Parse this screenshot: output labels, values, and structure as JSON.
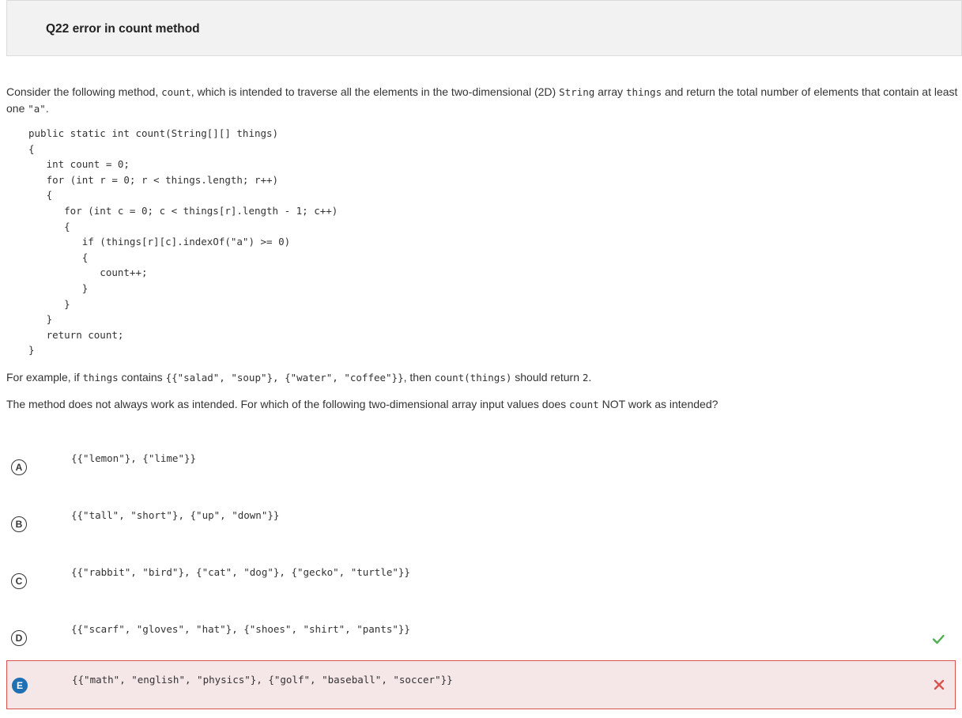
{
  "header": {
    "title": "Q22 error in count method"
  },
  "question": {
    "intro": {
      "t1": "Consider the following method, ",
      "c1": "count",
      "t2": ", which is intended to traverse all the elements in the two-dimensional (2D) ",
      "c2": "String",
      "t3": " array ",
      "c3": "things",
      "t4": " and return the total number of elements that contain at least one ",
      "c4": "\"a\"",
      "t5": "."
    },
    "code": [
      "public static int count(String[][] things)",
      "{",
      "   int count = 0;",
      "   for (int r = 0; r < things.length; r++)",
      "   {",
      "      for (int c = 0; c < things[r].length - 1; c++)",
      "      {",
      "         if (things[r][c].indexOf(\"a\") >= 0)",
      "         {",
      "            count++;",
      "         }",
      "      }",
      "   }",
      "   return count;",
      "}"
    ],
    "example": {
      "t1": "For example, if ",
      "c1": "things",
      "t2": " contains ",
      "c2": "{{\"salad\", \"soup\"}, {\"water\", \"coffee\"}}",
      "t3": ", then ",
      "c3": "count(things)",
      "t4": " should return ",
      "c4": "2",
      "t5": "."
    },
    "prompt": {
      "t1": "The method does not always work as intended. For which of the following two-dimensional array input values does ",
      "c1": "count",
      "t2": " NOT work as intended?"
    }
  },
  "choices": [
    {
      "letter": "A",
      "text": "{{\"lemon\"}, {\"lime\"}}"
    },
    {
      "letter": "B",
      "text": "{{\"tall\", \"short\"}, {\"up\", \"down\"}}"
    },
    {
      "letter": "C",
      "text": "{{\"rabbit\", \"bird\"}, {\"cat\", \"dog\"}, {\"gecko\", \"turtle\"}}"
    },
    {
      "letter": "D",
      "text": "{{\"scarf\", \"gloves\", \"hat\"}, {\"shoes\", \"shirt\", \"pants\"}}",
      "mark": "check-icon"
    },
    {
      "letter": "E",
      "text": "{{\"math\", \"english\", \"physics\"}, {\"golf\", \"baseball\", \"soccer\"}}",
      "mark": "x-icon",
      "selected": true
    }
  ],
  "colors": {
    "correct": "#4caf50",
    "incorrect": "#d9534f",
    "selected_bg": "#f5e6e8",
    "selected_letter": "#1f6fb3"
  }
}
